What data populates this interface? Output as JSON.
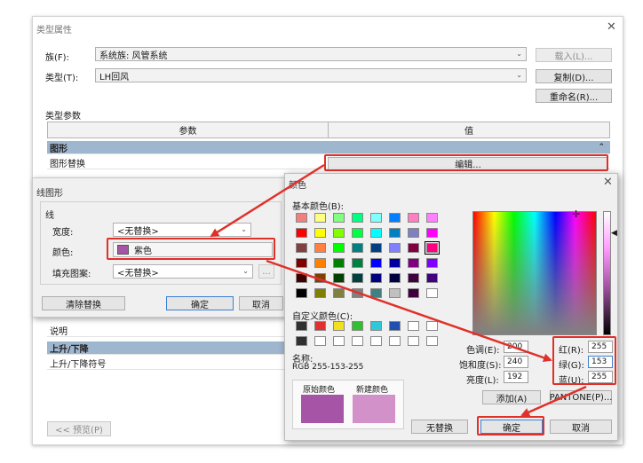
{
  "type_props": {
    "title": "类型属性",
    "family_label": "族(F):",
    "family_value": "系统族: 风管系统",
    "type_label": "类型(T):",
    "type_value": "LH回风",
    "load_btn": "载入(L)...",
    "copy_btn": "复制(D)...",
    "rename_btn": "重命名(R)...",
    "params_label": "类型参数",
    "col_param": "参数",
    "col_value": "值",
    "group_graphics": "图形",
    "row_graphic_override": "图形替换",
    "edit_btn": "编辑...",
    "row_desc": "说明",
    "group_rise": "上升/下降",
    "row_rise_symbol": "上升/下降符号",
    "preview_btn": "<< 预览(P)",
    "chevron": "»"
  },
  "line_graphics": {
    "title": "线图形",
    "group_title": "线",
    "width_label": "宽度:",
    "width_value": "<无替换>",
    "color_label": "颜色:",
    "color_value": "紫色",
    "fill_label": "填充图案:",
    "fill_value": "<无替换>",
    "browse_btn": "...",
    "clear_btn": "清除替换",
    "ok_btn": "确定",
    "cancel_btn": "取消",
    "swatch_color": "#a655a6"
  },
  "color_dialog": {
    "title": "颜色",
    "basic_label": "基本颜色(B):",
    "custom_label": "自定义颜色(C):",
    "name_label": "名称:",
    "name_value": "RGB 255-153-255",
    "orig_label": "原始颜色",
    "new_label": "新建颜色",
    "orig_color": "#a655a6",
    "new_color": "#d391c9",
    "hue_label": "色调(E):",
    "hue": "200",
    "sat_label": "饱和度(S):",
    "sat": "240",
    "lum_label": "亮度(L):",
    "lum": "192",
    "red_label": "红(R):",
    "red": "255",
    "green_label": "绿(G):",
    "green": "153",
    "blue_label": "蓝(U):",
    "blue": "255",
    "add_btn": "添加(A)",
    "pantone_btn": "PANTONE(P)...",
    "none_btn": "无替换",
    "ok_btn": "确定",
    "cancel_btn": "取消",
    "basic_colors": [
      "#f08080",
      "#ffff80",
      "#80ff80",
      "#00ff80",
      "#80ffff",
      "#0080ff",
      "#ff80c0",
      "#ff80ff",
      "#ff0000",
      "#ffff00",
      "#80ff00",
      "#00ff40",
      "#00ffff",
      "#0080c0",
      "#8080c0",
      "#ff00ff",
      "#804040",
      "#ff8040",
      "#00ff00",
      "#008080",
      "#004080",
      "#8080ff",
      "#800040",
      "#ff0080",
      "#800000",
      "#ff8000",
      "#008000",
      "#008040",
      "#0000ff",
      "#0000a0",
      "#800080",
      "#8000ff",
      "#400000",
      "#804000",
      "#004000",
      "#004040",
      "#000080",
      "#000040",
      "#400040",
      "#400080",
      "#000000",
      "#808000",
      "#808040",
      "#808080",
      "#408080",
      "#c0c0c0",
      "#400040",
      "#ffffff"
    ],
    "custom_colors": [
      "#303030",
      "#e03030",
      "#f0e020",
      "#30c030",
      "#30c8d8",
      "#2050b0",
      "#ffffff",
      "#ffffff",
      "#303030",
      "#ffffff",
      "#ffffff",
      "#ffffff",
      "#ffffff",
      "#ffffff",
      "#ffffff",
      "#ffffff"
    ]
  }
}
